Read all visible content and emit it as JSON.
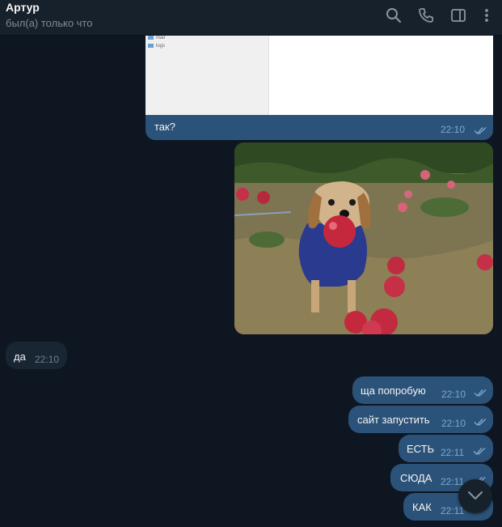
{
  "header": {
    "name": "Артур",
    "status": "был(а) только что",
    "icons": [
      "search-icon",
      "phone-icon",
      "sidebar-toggle-icon",
      "more-vertical-icon"
    ]
  },
  "messages": [
    {
      "direction": "out",
      "type": "file-preview",
      "folder_items": [
        "mail",
        "logs"
      ]
    },
    {
      "direction": "out",
      "type": "caption",
      "text": "так?",
      "time": "22:10",
      "read": true
    },
    {
      "direction": "out",
      "type": "photo"
    },
    {
      "direction": "in",
      "text": "да",
      "time": "22:10"
    },
    {
      "direction": "out",
      "text": "ща попробую",
      "time": "22:10",
      "read": true
    },
    {
      "direction": "out",
      "text": "сайт запустить",
      "time": "22:10",
      "read": true
    },
    {
      "direction": "out",
      "text": "ЕСТЬ",
      "time": "22:11",
      "read": true
    },
    {
      "direction": "out",
      "text": "СЮДА",
      "time": "22:11",
      "read": true
    },
    {
      "direction": "out",
      "text": "КАК",
      "time": "22:11",
      "read": true
    }
  ],
  "colors": {
    "background": "#0e1621",
    "header": "#17212b",
    "outgoing_bubble": "#2b5278",
    "incoming_bubble": "#182533",
    "time_out": "#7da8d3"
  }
}
